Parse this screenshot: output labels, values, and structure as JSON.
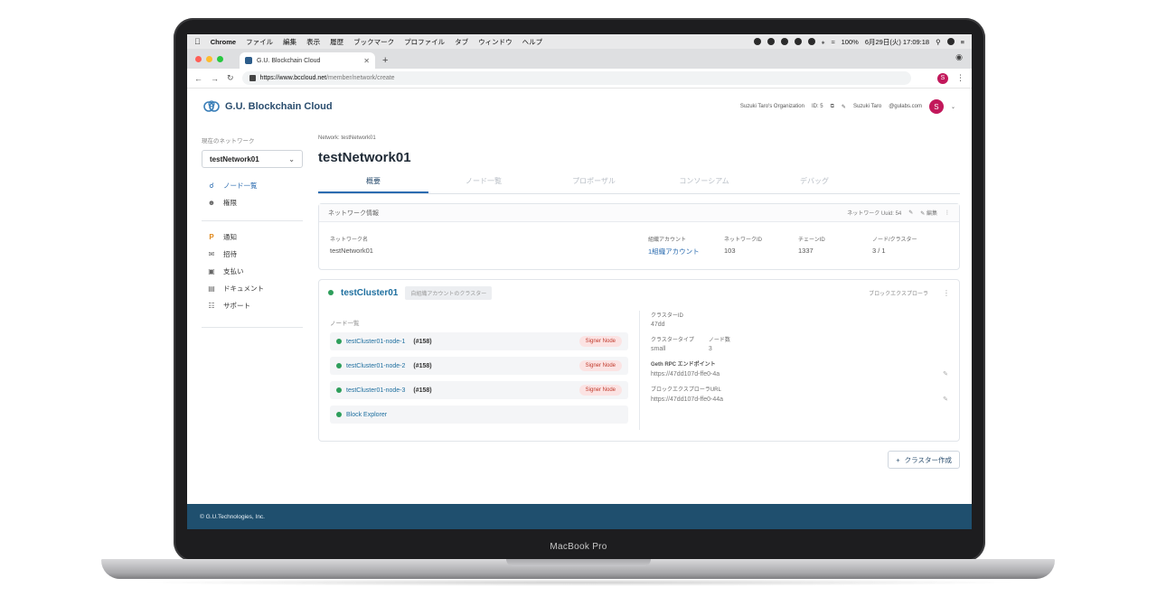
{
  "device": {
    "label": "MacBook Pro"
  },
  "menubar": {
    "app": "Chrome",
    "items": [
      "ファイル",
      "編集",
      "表示",
      "履歴",
      "ブックマーク",
      "プロファイル",
      "タブ",
      "ウィンドウ",
      "ヘルプ"
    ],
    "battery": "100%",
    "datetime": "6月29日(火) 17:09:18"
  },
  "browser": {
    "tab_title": "G.U. Blockchain Cloud",
    "url_host": "https://www.bccloud.net",
    "url_path": "/member/network/create",
    "profile_initial": "S"
  },
  "header": {
    "brand": "G.U. Blockchain Cloud",
    "org": "Suzuki Taro's Organization",
    "org_id": "ID: 5",
    "user": "Suzuki Taro",
    "email": "@gulabs.com",
    "avatar": "S"
  },
  "sidebar": {
    "caption": "現在のネットワーク",
    "selected_network": "testNetwork01",
    "nav": [
      {
        "label": "ノード一覧",
        "icon": "share-icon",
        "active": true
      },
      {
        "label": "権限",
        "icon": "user-icon",
        "active": false
      }
    ],
    "links": [
      {
        "label": "通知",
        "icon": "notification-icon"
      },
      {
        "label": "招待",
        "icon": "mail-icon"
      },
      {
        "label": "支払い",
        "icon": "card-icon"
      },
      {
        "label": "ドキュメント",
        "icon": "document-icon"
      },
      {
        "label": "サポート",
        "icon": "chat-icon"
      }
    ]
  },
  "main": {
    "breadcrumb": "Network: testNetwork01",
    "title": "testNetwork01",
    "tabs": [
      "概要",
      "ノード一覧",
      "プロポーザル",
      "コンソーシアム",
      "デバッグ"
    ],
    "active_tab": 0
  },
  "network_card": {
    "title": "ネットワーク情報",
    "uuid_label": "ネットワーク Uuid: 54",
    "edit_label": "編集",
    "fields": {
      "name_label": "ネットワーク名",
      "name_value": "testNetwork01",
      "account_label": "組織アカウント",
      "account_value": "1組織アカウント",
      "network_id_label": "ネットワークID",
      "network_id_value": "103",
      "chain_id_label": "チェーンID",
      "chain_id_value": "1337",
      "nodes_label": "ノード/クラスター",
      "nodes_value": "3 / 1"
    }
  },
  "cluster_card": {
    "name": "testCluster01",
    "tag": "自組織アカウントのクラスター",
    "explorer_label": "ブロックエクスプローラ",
    "nodes_caption": "ノード一覧",
    "nodes": [
      {
        "name": "testCluster01-node-1",
        "num": "(#158)",
        "badge": "Signer Node"
      },
      {
        "name": "testCluster01-node-2",
        "num": "(#158)",
        "badge": "Signer Node"
      },
      {
        "name": "testCluster01-node-3",
        "num": "(#158)",
        "badge": "Signer Node"
      }
    ],
    "explorer_row": "Block Explorer",
    "details": {
      "cluster_id_label": "クラスターID",
      "cluster_id_value": "47dd",
      "type_label": "クラスタータイプ",
      "type_value": "small",
      "node_count_label": "ノード数",
      "node_count_value": "3",
      "rpc_label": "Geth RPC エンドポイント",
      "rpc_value": "https://47dd107d-ffe0-4a",
      "explorer_url_label": "ブロックエクスプローラURL",
      "explorer_url_value": "https://47dd107d-ffe0-44a"
    }
  },
  "actions": {
    "add_cluster": "クラスター作成"
  },
  "footer": {
    "copyright": "© G.U.Technologies, Inc."
  },
  "colors": {
    "accent": "#2b6cb0",
    "footer": "#1f4f6e",
    "avatar": "#c2185b",
    "online": "#2e9e5b"
  }
}
